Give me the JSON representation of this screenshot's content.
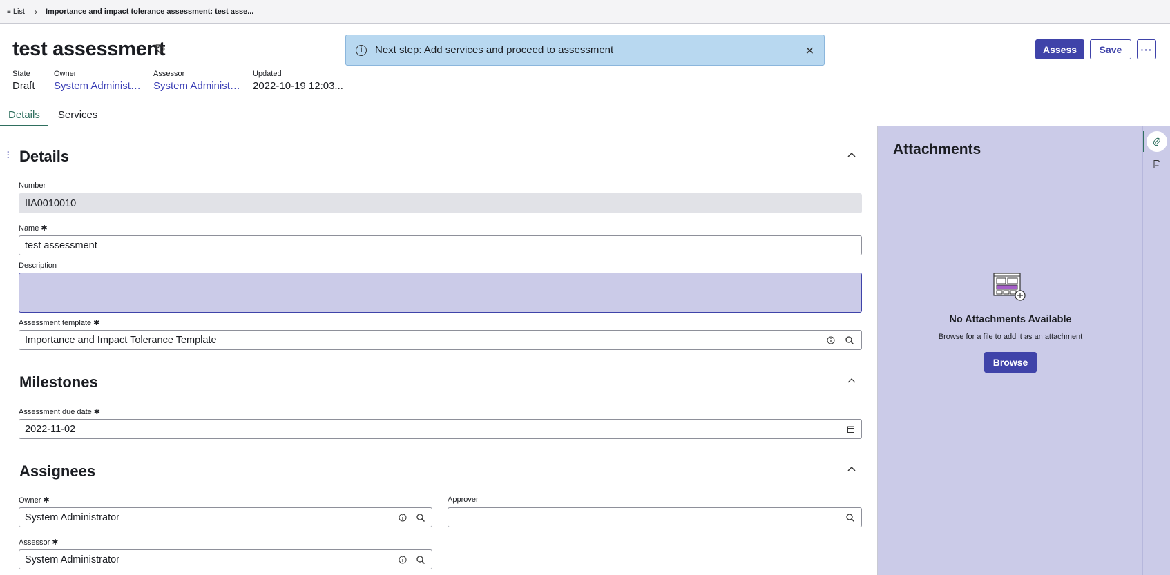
{
  "breadcrumb": {
    "list_label": "List",
    "current": "Importance and impact tolerance assessment: test asse..."
  },
  "header": {
    "title": "test assessment",
    "meta": [
      {
        "label": "State",
        "value": "Draft"
      },
      {
        "label": "Owner",
        "value": "System Administra..."
      },
      {
        "label": "Assessor",
        "value": "System Administra..."
      },
      {
        "label": "Updated",
        "value": "2022-10-19 12:03..."
      }
    ],
    "buttons": {
      "assess": "Assess",
      "save": "Save",
      "more": "···"
    }
  },
  "banner": {
    "message": "Next step: Add services and proceed to assessment"
  },
  "tabs": [
    {
      "label": "Details",
      "active": true
    },
    {
      "label": "Services",
      "active": false
    }
  ],
  "form": {
    "details_title": "Details",
    "number_label": "Number",
    "number_value": "IIA0010010",
    "name_label": "Name",
    "name_value": "test assessment",
    "description_label": "Description",
    "template_label": "Assessment template",
    "template_value": "Importance and Impact Tolerance Template",
    "milestones_title": "Milestones",
    "due_label": "Assessment due date",
    "due_value": "2022-11-02",
    "assignees_title": "Assignees",
    "owner_label": "Owner",
    "owner_value": "System Administrator",
    "approver_label": "Approver",
    "approver_value": "",
    "assessor_label": "Assessor",
    "assessor_value": "System Administrator",
    "required_mark": "✱"
  },
  "attachments": {
    "title": "Attachments",
    "empty_title": "No Attachments Available",
    "hint": "Browse for a file to add it as an attachment",
    "browse_label": "Browse"
  },
  "colors": {
    "primary": "#3f43a9",
    "panel": "#cbcbe8",
    "banner": "#b8d8f0",
    "tab_active": "#2f6f5f"
  },
  "icons": [
    "list-icon",
    "chevron-right-icon",
    "tag-icon",
    "info-icon",
    "close-icon",
    "more-icon",
    "chevron-up-icon",
    "search-icon",
    "calendar-icon",
    "paperclip-icon",
    "document-icon",
    "attachment-illustration"
  ]
}
